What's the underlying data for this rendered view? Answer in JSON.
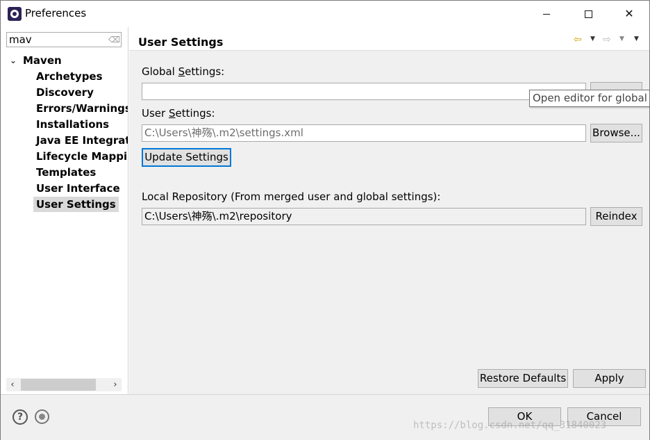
{
  "window": {
    "title": "Preferences"
  },
  "filter": {
    "value": "mav"
  },
  "tree": {
    "root": "Maven",
    "children": [
      "Archetypes",
      "Discovery",
      "Errors/Warnings",
      "Installations",
      "Java EE Integrati",
      "Lifecycle Mappir",
      "Templates",
      "User Interface",
      "User Settings"
    ],
    "selected": "User Settings"
  },
  "page": {
    "title": "User Settings",
    "global_settings_label_pre": "Global ",
    "global_settings_label_mnemonic": "S",
    "global_settings_label_post": "ettings:",
    "global_settings_value": "",
    "user_settings_label_pre": "User ",
    "user_settings_label_mnemonic": "S",
    "user_settings_label_post": "ettings:",
    "user_settings_value": "C:\\Users\\神殇\\.m2\\settings.xml",
    "browse_label": "Browse...",
    "update_settings_label": "Update Settings",
    "local_repo_label": "Local Repository (From merged user and global settings):",
    "local_repo_value": "C:\\Users\\神殇\\.m2\\repository",
    "reindex_label": "Reindex",
    "restore_defaults_label": "Restore Defaults",
    "apply_label": "Apply",
    "tooltip": "Open editor for global s"
  },
  "dialog": {
    "ok_label": "OK",
    "cancel_label": "Cancel"
  },
  "watermark": "https://blog.csdn.net/qq_31840023",
  "colors": {
    "selection": "#d9d9d9",
    "focus": "#0078d7",
    "back_arrow": "#d8a400"
  },
  "icons": {
    "app": "eclipse-icon",
    "help": "help-icon",
    "record": "record-macro-icon"
  }
}
